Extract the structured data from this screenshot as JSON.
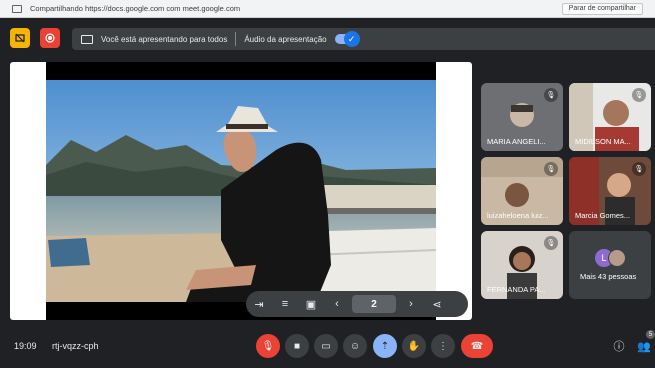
{
  "sharebar": {
    "text": "Compartilhando https://docs.google.com com meet.google.com",
    "stop_label": "Parar de compartilhar"
  },
  "presentbar": {
    "presenting_text": "Você está apresentando para todos",
    "audio_text": "Áudio da apresentação"
  },
  "slide_controls": {
    "page": "2"
  },
  "participants": [
    {
      "name": "MARIA ANGELI..."
    },
    {
      "name": "MIDILSON MA..."
    },
    {
      "name": "luizaheloena luiz..."
    },
    {
      "name": "Marcia Gomes..."
    },
    {
      "name": "FERNANDA PA..."
    },
    {
      "name": "Mais 43 pessoas",
      "avatar_letter": "L"
    }
  ],
  "meeting": {
    "time": "19:09",
    "code": "rtj-vqzz-cph"
  },
  "people_count": "5",
  "colors": {
    "background": "#202124",
    "surface": "#3c4043",
    "red": "#ea4335",
    "blue": "#8ab4f8",
    "yellow": "#f4b400"
  }
}
